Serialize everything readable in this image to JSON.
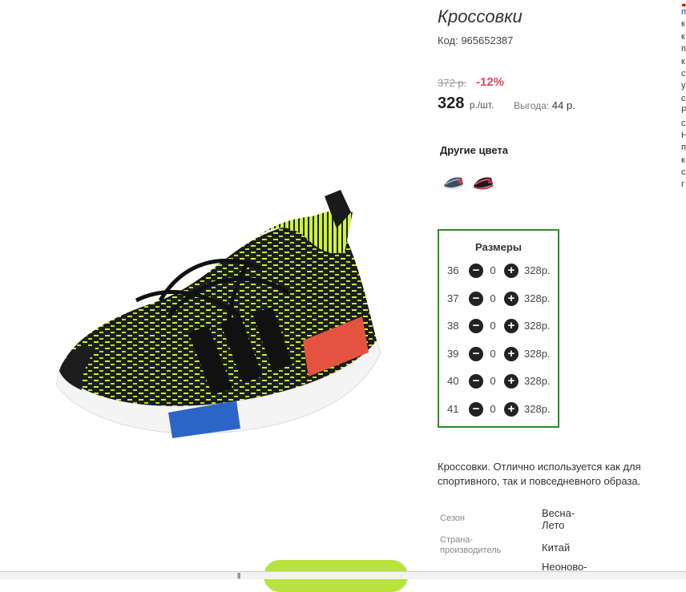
{
  "product": {
    "title": "Кроссовки",
    "code": "Код: 965652387",
    "old_price": "372 р.",
    "discount": "-12%",
    "price": "328",
    "price_unit": "р./шт.",
    "savings_label": "Выгода:",
    "savings_value": "44 р.",
    "description": "Кроссовки. Отлично используется как для спортивного, так и повседневного образа."
  },
  "other_colors": {
    "title": "Другие цвета",
    "swatches": [
      {
        "name": "gray-blue-red",
        "colors": [
          "#3a4b66",
          "#9aa4b3",
          "#d83a2e"
        ]
      },
      {
        "name": "black-red",
        "colors": [
          "#1b1b1b",
          "#c2263d",
          "#e84a5e"
        ]
      }
    ]
  },
  "sizes": {
    "title": "Размеры",
    "minus_icon": "−",
    "plus_icon": "+",
    "rows": [
      {
        "size": "36",
        "qty": "0",
        "price": "328р."
      },
      {
        "size": "37",
        "qty": "0",
        "price": "328р."
      },
      {
        "size": "38",
        "qty": "0",
        "price": "328р."
      },
      {
        "size": "39",
        "qty": "0",
        "price": "328р."
      },
      {
        "size": "40",
        "qty": "0",
        "price": "328р."
      },
      {
        "size": "41",
        "qty": "0",
        "price": "328р."
      }
    ]
  },
  "specs": [
    {
      "label": "Сезон",
      "value": "Весна-\nЛето"
    },
    {
      "label": "Страна-\nпроизводитель",
      "value": "Китай"
    },
    {
      "label": "",
      "value": "Неоново-"
    }
  ],
  "right_edge_chars": [
    "п",
    "к",
    "к",
    "п",
    "к",
    "с",
    "у",
    "с",
    "Р",
    "с",
    "Н",
    "п",
    "к",
    "с",
    "г"
  ],
  "scroll_grip": "|||",
  "colors": {
    "accent_green": "#2e8b2e",
    "discount_red": "#e0455a",
    "cart_button": "#b9e23e"
  }
}
